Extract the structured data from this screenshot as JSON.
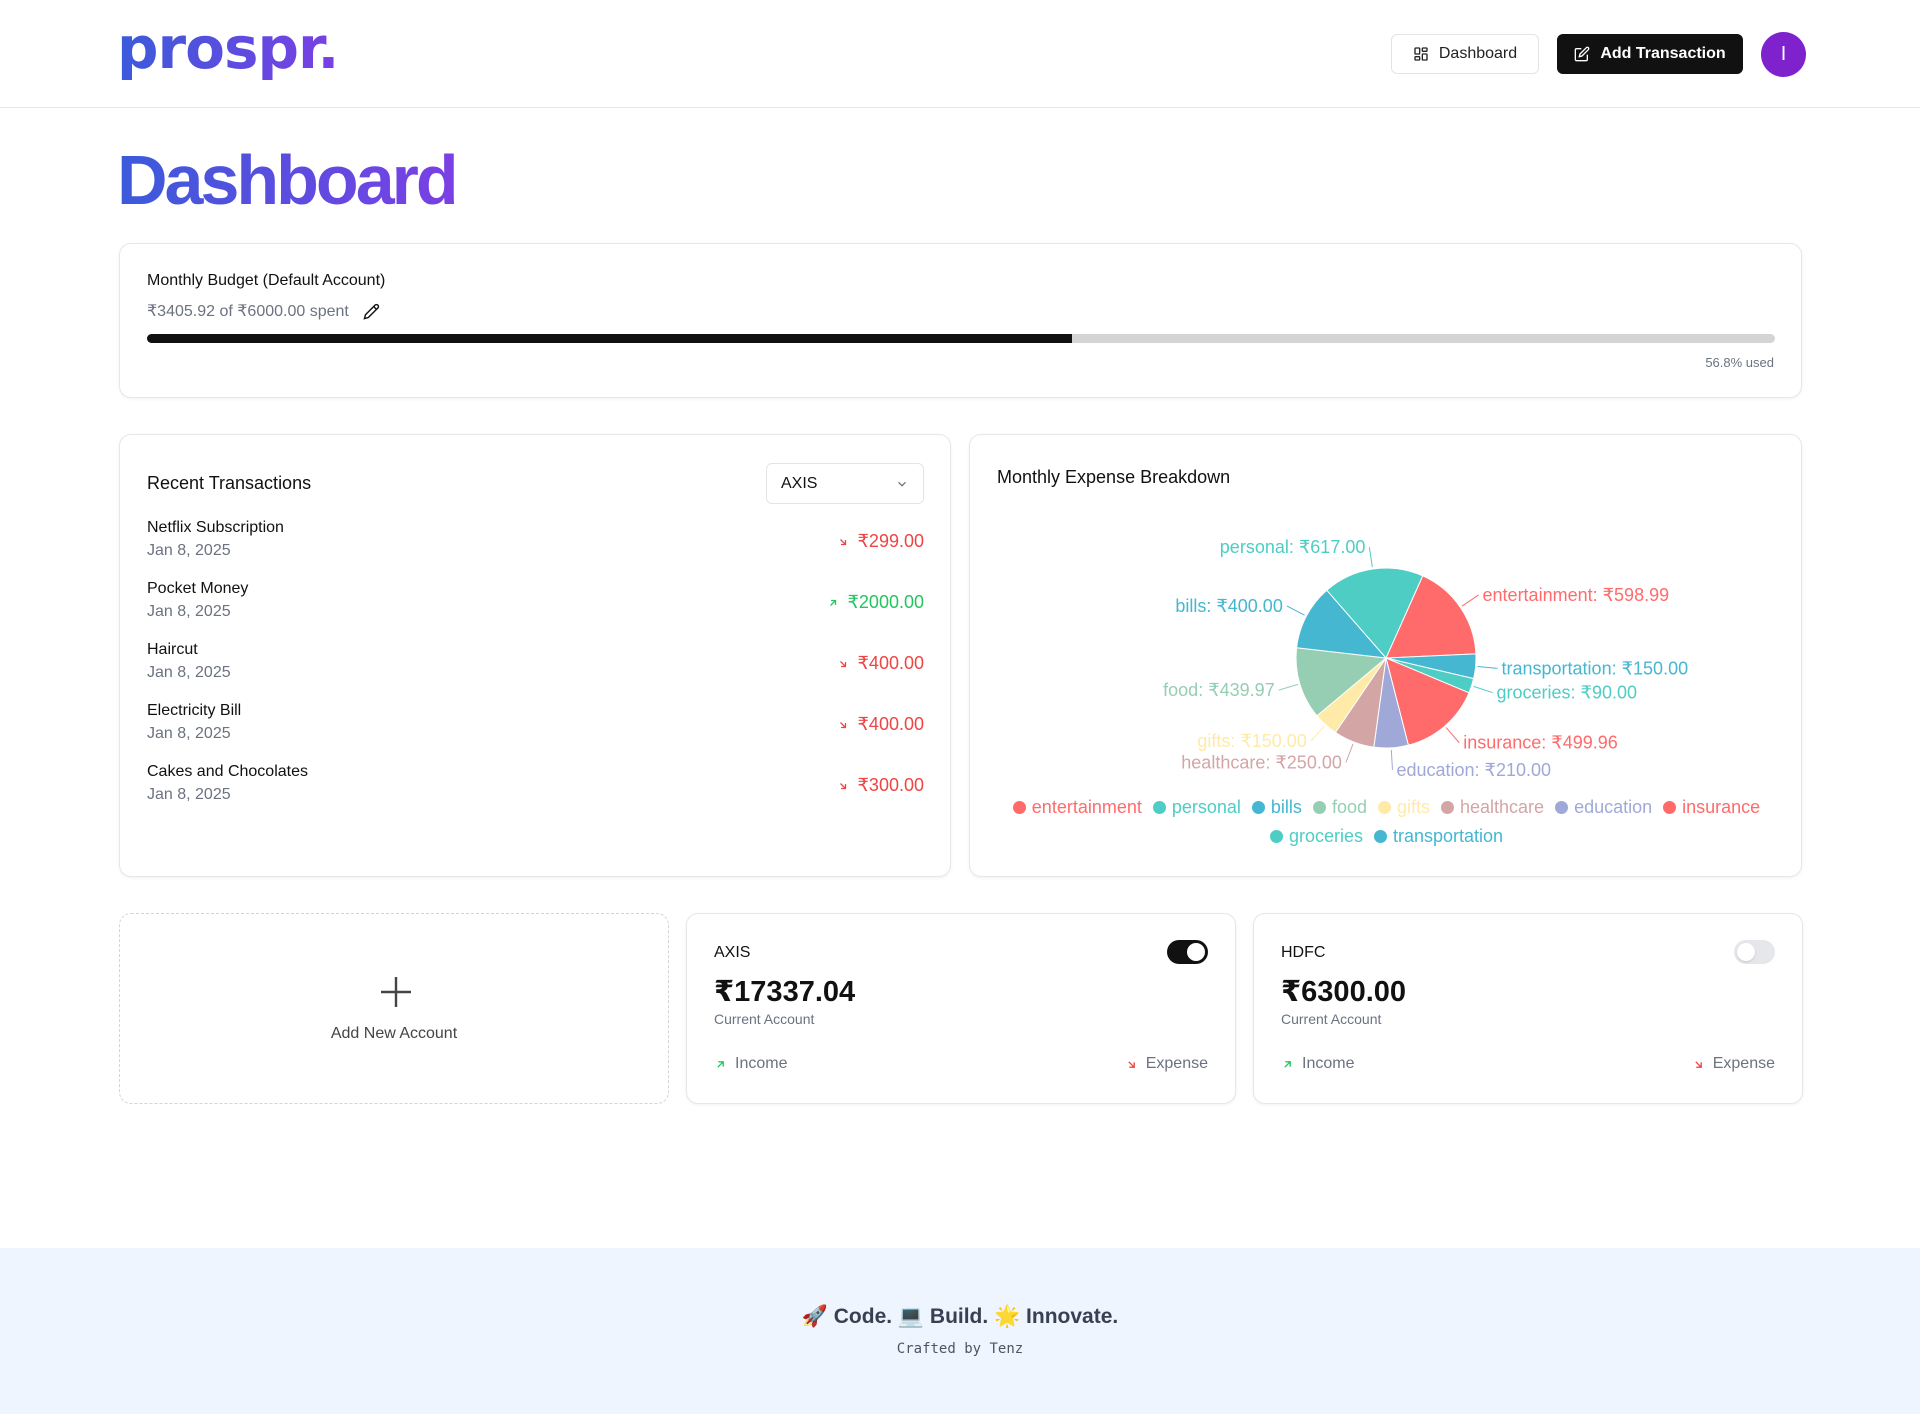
{
  "header": {
    "logo": "prospr.",
    "dashboard_label": "Dashboard",
    "add_transaction_label": "Add Transaction",
    "avatar_initial": "I",
    "avatar_color": "#7e22ce"
  },
  "page": {
    "title": "Dashboard"
  },
  "budget": {
    "title": "Monthly Budget (Default Account)",
    "spent_text": "₹3405.92 of ₹6000.00 spent",
    "used_percent": 56.8,
    "used_text": "56.8% used"
  },
  "recent": {
    "title": "Recent Transactions",
    "account_select": "AXIS",
    "transactions": [
      {
        "name": "Netflix Subscription",
        "date": "Jan 8, 2025",
        "amount": "₹299.00",
        "type": "expense"
      },
      {
        "name": "Pocket Money",
        "date": "Jan 8, 2025",
        "amount": "₹2000.00",
        "type": "income"
      },
      {
        "name": "Haircut",
        "date": "Jan 8, 2025",
        "amount": "₹400.00",
        "type": "expense"
      },
      {
        "name": "Electricity Bill",
        "date": "Jan 8, 2025",
        "amount": "₹400.00",
        "type": "expense"
      },
      {
        "name": "Cakes and Chocolates",
        "date": "Jan 8, 2025",
        "amount": "₹300.00",
        "type": "expense"
      }
    ]
  },
  "breakdown": {
    "title": "Monthly Expense Breakdown"
  },
  "chart_data": {
    "type": "pie",
    "categories": [
      "entertainment",
      "transportation",
      "groceries",
      "insurance",
      "education",
      "healthcare",
      "gifts",
      "food",
      "bills",
      "personal"
    ],
    "values": [
      598.99,
      150.0,
      90.0,
      499.96,
      210.0,
      250.0,
      150.0,
      439.97,
      400.0,
      617.0
    ],
    "labels": [
      "entertainment: ₹598.99",
      "transportation: ₹150.00",
      "groceries: ₹90.00",
      "insurance: ₹499.96",
      "education: ₹210.00",
      "healthcare: ₹250.00",
      "gifts: ₹150.00",
      "food: ₹439.97",
      "bills: ₹400.00",
      "personal: ₹617.00"
    ],
    "colors": [
      "#ff6b6b",
      "#45b7d1",
      "#4ecdc4",
      "#ff6b6b",
      "#a0a8d8",
      "#d4a5a5",
      "#ffeaa7",
      "#96ceb4",
      "#45b7d1",
      "#4ecdc4"
    ],
    "legend": [
      {
        "name": "entertainment",
        "color": "#ff6b6b"
      },
      {
        "name": "personal",
        "color": "#4ecdc4"
      },
      {
        "name": "bills",
        "color": "#45b7d1"
      },
      {
        "name": "food",
        "color": "#96ceb4"
      },
      {
        "name": "gifts",
        "color": "#ffeaa7"
      },
      {
        "name": "healthcare",
        "color": "#d4a5a5"
      },
      {
        "name": "education",
        "color": "#a0a8d8"
      },
      {
        "name": "insurance",
        "color": "#ff6b6b"
      },
      {
        "name": "groceries",
        "color": "#4ecdc4"
      },
      {
        "name": "transportation",
        "color": "#45b7d1"
      }
    ]
  },
  "accounts": {
    "add_label": "Add New Account",
    "items": [
      {
        "name": "AXIS",
        "balance": "₹17337.04",
        "type": "Current Account",
        "default": true,
        "income_label": "Income",
        "expense_label": "Expense"
      },
      {
        "name": "HDFC",
        "balance": "₹6300.00",
        "type": "Current Account",
        "default": false,
        "income_label": "Income",
        "expense_label": "Expense"
      }
    ]
  },
  "footer": {
    "tagline": "🚀 Code. 💻 Build. 🌟 Innovate.",
    "credit": "Crafted by Tenz"
  }
}
